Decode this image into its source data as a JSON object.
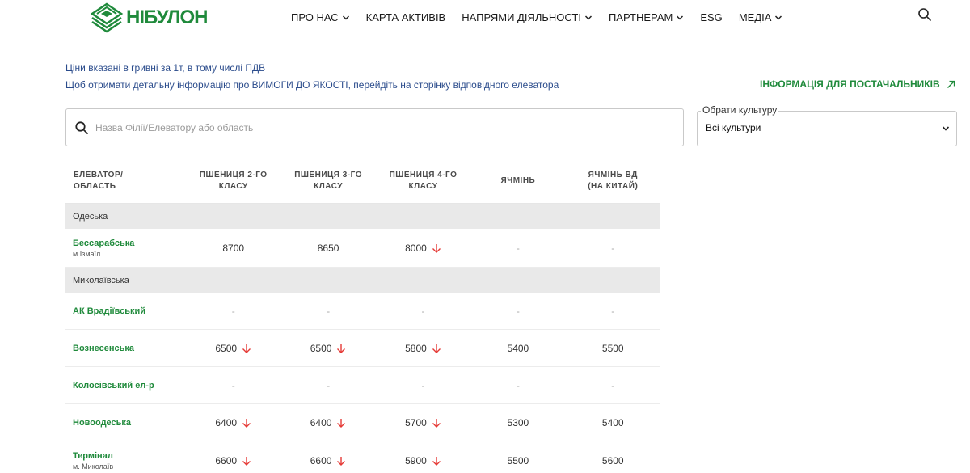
{
  "brand": {
    "name": "НІБУЛОН",
    "color": "#1f8a3b"
  },
  "nav": [
    {
      "label": "ПРО НАС",
      "dropdown": true
    },
    {
      "label": "КАРТА АКТИВІВ",
      "dropdown": false
    },
    {
      "label": "НАПРЯМИ ДІЯЛЬНОСТІ",
      "dropdown": true
    },
    {
      "label": "ПАРТНЕРАМ",
      "dropdown": true
    },
    {
      "label": "ESG",
      "dropdown": false
    },
    {
      "label": "МЕДІА",
      "dropdown": true
    }
  ],
  "info": {
    "prices_note": "Ціни вказані в гривні за 1т, в тому числі ПДВ",
    "quality_note": "Щоб отримати детальну інформацію про ВИМОГИ ДО ЯКОСТІ, перейдіть на сторінку відповідного елеватора",
    "suppliers_link": "ІНФОРМАЦІЯ ДЛЯ ПОСТАЧАЛЬНИКІВ"
  },
  "search": {
    "placeholder": "Назва Філії/Елеватору або область",
    "value": ""
  },
  "culture_select": {
    "legend": "Обрати культуру",
    "value": "Всі культури"
  },
  "table": {
    "headers": [
      "ЕЛЕВАТОР/\nОБЛАСТЬ",
      "ПШЕНИЦЯ 2-ГО\nКЛАСУ",
      "ПШЕНИЦЯ 3-ГО\nКЛАСУ",
      "ПШЕНИЦЯ 4-ГО\nКЛАСУ",
      "ЯЧМІНЬ",
      "ЯЧМІНЬ ВД\n(НА КИТАЙ)"
    ],
    "groups": [
      {
        "region": "Одеська",
        "rows": [
          {
            "name": "Бессарабська",
            "city": "м.Ізмаїл",
            "cells": [
              {
                "v": "8700",
                "down": false
              },
              {
                "v": "8650",
                "down": false
              },
              {
                "v": "8000",
                "down": true
              },
              {
                "v": "-",
                "down": false
              },
              {
                "v": "-",
                "down": false
              }
            ]
          }
        ]
      },
      {
        "region": "Миколаївська",
        "rows": [
          {
            "name": "АК Врадіївський",
            "city": "",
            "cells": [
              {
                "v": "-",
                "down": false
              },
              {
                "v": "-",
                "down": false
              },
              {
                "v": "-",
                "down": false
              },
              {
                "v": "-",
                "down": false
              },
              {
                "v": "-",
                "down": false
              }
            ]
          },
          {
            "name": "Вознесенська",
            "city": "",
            "cells": [
              {
                "v": "6500",
                "down": true
              },
              {
                "v": "6500",
                "down": true
              },
              {
                "v": "5800",
                "down": true
              },
              {
                "v": "5400",
                "down": false
              },
              {
                "v": "5500",
                "down": false
              }
            ]
          },
          {
            "name": "Колосівський ел-р",
            "city": "",
            "cells": [
              {
                "v": "-",
                "down": false
              },
              {
                "v": "-",
                "down": false
              },
              {
                "v": "-",
                "down": false
              },
              {
                "v": "-",
                "down": false
              },
              {
                "v": "-",
                "down": false
              }
            ]
          },
          {
            "name": "Новоодеська",
            "city": "",
            "cells": [
              {
                "v": "6400",
                "down": true
              },
              {
                "v": "6400",
                "down": true
              },
              {
                "v": "5700",
                "down": true
              },
              {
                "v": "5300",
                "down": false
              },
              {
                "v": "5400",
                "down": false
              }
            ]
          },
          {
            "name": "Термінал",
            "city": "м. Миколаїв",
            "cells": [
              {
                "v": "6600",
                "down": true
              },
              {
                "v": "6600",
                "down": true
              },
              {
                "v": "5900",
                "down": true
              },
              {
                "v": "5500",
                "down": false
              },
              {
                "v": "5600",
                "down": false
              }
            ]
          }
        ]
      }
    ]
  },
  "colors": {
    "accent_green": "#1f8a3b",
    "info_blue": "#2b4c8c",
    "down_red": "#e53935",
    "region_bg": "#e9e9e9"
  }
}
